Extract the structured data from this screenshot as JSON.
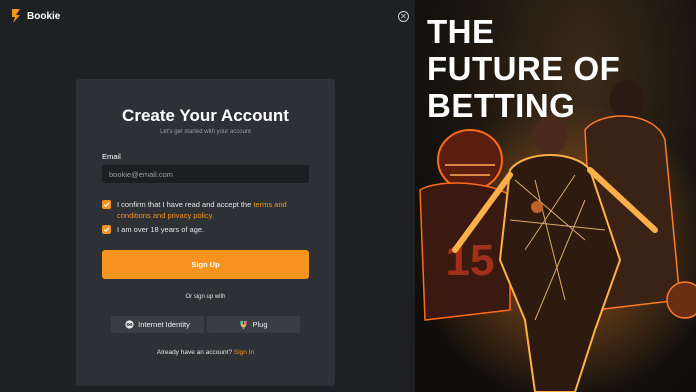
{
  "app": {
    "name": "Bookie"
  },
  "form": {
    "title": "Create Your Account",
    "subtitle": "Let's get started with your account",
    "email_label": "Email",
    "email_placeholder": "bookie@email.com",
    "email_value": "",
    "terms_text": "I confirm that I have read and accept the ",
    "terms_link": "terms and conditions and privacy policy.",
    "terms_checked": true,
    "age_text": "I am over 18 years of age.",
    "age_checked": true,
    "signup_label": "Sign Up",
    "or_text": "Or sign up with",
    "providers": [
      {
        "label": "Internet Identity",
        "icon": "infinity-icon"
      },
      {
        "label": "Plug",
        "icon": "plug-icon"
      }
    ],
    "have_account_text": "Already have an account? ",
    "signin_link": "Sign In"
  },
  "hero": {
    "lines": [
      "THE",
      "FUTURE OF",
      "BETTING"
    ]
  },
  "colors": {
    "accent": "#f5931e",
    "card": "#2d3034",
    "background": "#1f2024"
  }
}
